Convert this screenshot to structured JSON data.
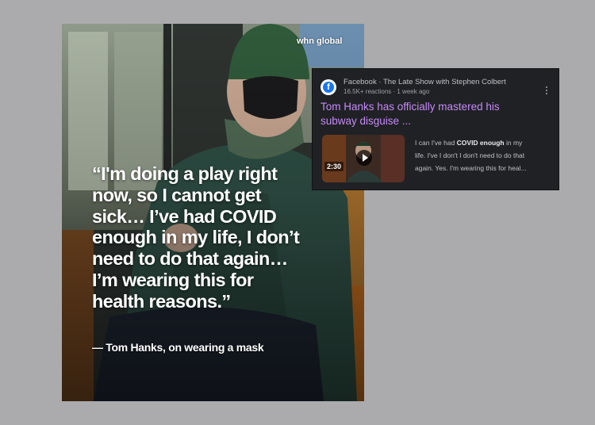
{
  "post": {
    "brand": "whn global",
    "quote_lines": [
      "“I'm doing a play right",
      "now, so I cannot get",
      "sick… I’ve had COVID",
      "enough in my life, I don’t",
      "need to do that again…",
      "I’m wearing this for",
      "health reasons.”"
    ],
    "attribution": "— Tom Hanks, on wearing a mask"
  },
  "result": {
    "source": "Facebook · The Late Show with Stephen Colbert",
    "meta": "16.5K+ reactions · 1 week ago",
    "title_lines": [
      "Tom Hanks has officially mastered his",
      "subway disguise ..."
    ],
    "duration": "2:30",
    "snippet": {
      "pre": "I can I've had ",
      "bold": "COVID enough",
      "post_line1": " in my",
      "line2": "life. I've I don't I don't need to do that",
      "line3": "again. Yes. I'm wearing this for heal..."
    }
  },
  "colors": {
    "background": "#ababad",
    "result_bg": "#202124",
    "title_link": "#c58af9",
    "facebook": "#1877f2"
  },
  "icons": [
    "facebook-icon",
    "more-vert-icon",
    "play-icon"
  ]
}
